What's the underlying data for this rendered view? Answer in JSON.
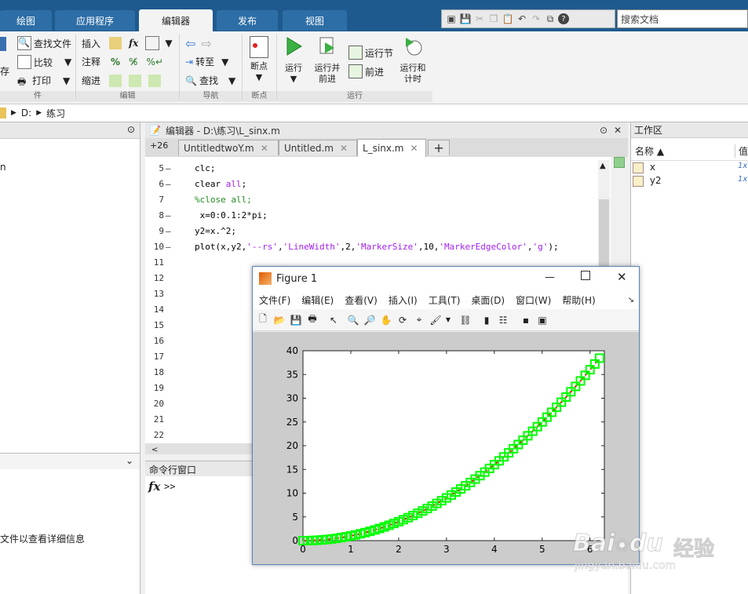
{
  "tabs": [
    {
      "label": "绘图",
      "active": false
    },
    {
      "label": "应用程序",
      "active": false
    },
    {
      "label": "编辑器",
      "active": true
    },
    {
      "label": "发布",
      "active": false
    },
    {
      "label": "视图",
      "active": false
    }
  ],
  "search_placeholder": "搜索文档",
  "ribbon": {
    "file": {
      "find_files": "查找文件",
      "compare": "比较",
      "print": "打印",
      "save_frag": "存"
    },
    "edit": {
      "insert": "插入",
      "comment": "注释",
      "indent": "缩进",
      "fx": "fx"
    },
    "nav": {
      "goto": "转至",
      "find": "查找"
    },
    "breakpoints": {
      "label": "断点"
    },
    "run": {
      "run": "运行",
      "run_advance_1": "运行并",
      "run_advance_2": "前进",
      "run_section": "运行节",
      "advance": "前进",
      "run_time_1": "运行和",
      "run_time_2": "计时"
    },
    "group_labels": {
      "file": "件",
      "edit": "编辑",
      "nav": "导航",
      "breakpoints": "断点",
      "run": "运行"
    }
  },
  "address": {
    "drive": "D:",
    "folder": "练习"
  },
  "left_panel": {
    "item_frag": "n",
    "details_msg": "文件以查看详细信息"
  },
  "editor": {
    "header": "编辑器 - D:\\练习\\L_sinx.m",
    "overflow": "+26",
    "tabs": [
      {
        "label": "UntitledtwoY.m",
        "active": false
      },
      {
        "label": "Untitled.m",
        "active": false
      },
      {
        "label": "L_sinx.m",
        "active": true
      }
    ],
    "lines": [
      {
        "n": "5",
        "dash": "–",
        "code": "clc;"
      },
      {
        "n": "6",
        "dash": "–",
        "code": "clear all;"
      },
      {
        "n": "7",
        "dash": "",
        "code": "%close all;"
      },
      {
        "n": "8",
        "dash": "–",
        "code": " x=0:0.1:2*pi;"
      },
      {
        "n": "9",
        "dash": "–",
        "code": "y2=x.^2;"
      },
      {
        "n": "10",
        "dash": "–",
        "code": "plot(x,y2,'--rs','LineWidth',2,'MarkerSize',10,'MarkerEdgeColor','g');"
      },
      {
        "n": "11",
        "dash": "",
        "code": ""
      },
      {
        "n": "12",
        "dash": "",
        "code": ""
      },
      {
        "n": "13",
        "dash": "",
        "code": ""
      },
      {
        "n": "14",
        "dash": "",
        "code": ""
      },
      {
        "n": "15",
        "dash": "",
        "code": ""
      },
      {
        "n": "16",
        "dash": "",
        "code": ""
      },
      {
        "n": "17",
        "dash": "",
        "code": ""
      },
      {
        "n": "18",
        "dash": "",
        "code": ""
      },
      {
        "n": "19",
        "dash": "",
        "code": ""
      },
      {
        "n": "20",
        "dash": "",
        "code": ""
      },
      {
        "n": "21",
        "dash": "",
        "code": ""
      },
      {
        "n": "22",
        "dash": "",
        "code": ""
      }
    ]
  },
  "command_window": {
    "title": "命令行窗口",
    "prompt": ">>"
  },
  "workspace": {
    "title": "工作区",
    "col_name": "名称 ▲",
    "col_value": "值",
    "vars": [
      {
        "name": "x",
        "value": "1x"
      },
      {
        "name": "y2",
        "value": "1x"
      }
    ]
  },
  "figure": {
    "title": "Figure 1",
    "menus": [
      "文件(F)",
      "编辑(E)",
      "查看(V)",
      "插入(I)",
      "工具(T)",
      "桌面(D)",
      "窗口(W)",
      "帮助(H)"
    ]
  },
  "chart_data": {
    "type": "scatter",
    "xlim": [
      0,
      6.3
    ],
    "ylim": [
      0,
      40
    ],
    "xticks": [
      0,
      1,
      2,
      3,
      4,
      5,
      6
    ],
    "yticks": [
      0,
      5,
      10,
      15,
      20,
      25,
      30,
      35,
      40
    ],
    "x": [
      0,
      0.1,
      0.2,
      0.3,
      0.4,
      0.5,
      0.6,
      0.7,
      0.8,
      0.9,
      1.0,
      1.1,
      1.2,
      1.3,
      1.4,
      1.5,
      1.6,
      1.7,
      1.8,
      1.9,
      2.0,
      2.1,
      2.2,
      2.3,
      2.4,
      2.5,
      2.6,
      2.7,
      2.8,
      2.9,
      3.0,
      3.1,
      3.2,
      3.3,
      3.4,
      3.5,
      3.6,
      3.7,
      3.8,
      3.9,
      4.0,
      4.1,
      4.2,
      4.3,
      4.4,
      4.5,
      4.6,
      4.7,
      4.8,
      4.9,
      5.0,
      5.1,
      5.2,
      5.3,
      5.4,
      5.5,
      5.6,
      5.7,
      5.8,
      5.9,
      6.0,
      6.1,
      6.2
    ],
    "y": [
      0,
      0.01,
      0.04,
      0.09,
      0.16,
      0.25,
      0.36,
      0.49,
      0.64,
      0.81,
      1.0,
      1.21,
      1.44,
      1.69,
      1.96,
      2.25,
      2.56,
      2.89,
      3.24,
      3.61,
      4.0,
      4.41,
      4.84,
      5.29,
      5.76,
      6.25,
      6.76,
      7.29,
      7.84,
      8.41,
      9.0,
      9.61,
      10.24,
      10.89,
      11.56,
      12.25,
      12.96,
      13.69,
      14.44,
      15.21,
      16.0,
      16.81,
      17.64,
      18.49,
      19.36,
      20.25,
      21.16,
      22.09,
      23.04,
      24.01,
      25.0,
      26.01,
      27.04,
      28.09,
      29.16,
      30.25,
      31.36,
      32.49,
      33.64,
      34.81,
      36.0,
      37.21,
      38.44
    ],
    "marker": "square",
    "marker_color": "#00ff00",
    "line_color": "#ff0000"
  },
  "watermark": {
    "brand": "Bai",
    "brand2": "du",
    "cn": "经验",
    "url": "jingyan.baidu.com"
  }
}
